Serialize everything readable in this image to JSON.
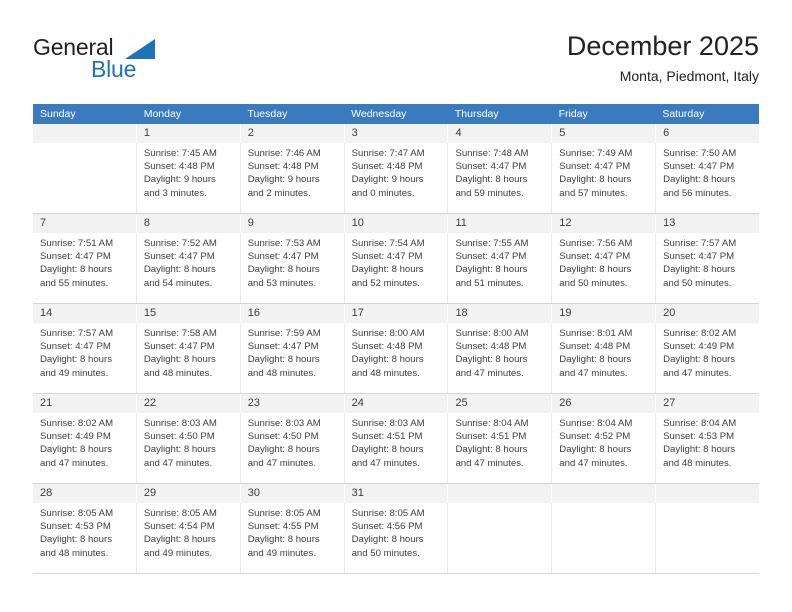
{
  "brand": {
    "name_part1": "General",
    "name_part2": "Blue",
    "accent_color": "#1e72bb",
    "logo_icon": "triangle-flag-icon"
  },
  "header": {
    "title": "December 2025",
    "subtitle": "Monta, Piedmont, Italy"
  },
  "calendar": {
    "header_bg": "#3a7bbf",
    "daynum_bg": "#f2f2f2",
    "weekdays": [
      "Sunday",
      "Monday",
      "Tuesday",
      "Wednesday",
      "Thursday",
      "Friday",
      "Saturday"
    ],
    "weeks": [
      {
        "days": [
          {
            "date": "",
            "sunrise": "",
            "sunset": "",
            "daylight_line1": "",
            "daylight_line2": "",
            "empty": true
          },
          {
            "date": "1",
            "sunrise": "Sunrise: 7:45 AM",
            "sunset": "Sunset: 4:48 PM",
            "daylight_line1": "Daylight: 9 hours",
            "daylight_line2": "and 3 minutes.",
            "empty": false
          },
          {
            "date": "2",
            "sunrise": "Sunrise: 7:46 AM",
            "sunset": "Sunset: 4:48 PM",
            "daylight_line1": "Daylight: 9 hours",
            "daylight_line2": "and 2 minutes.",
            "empty": false
          },
          {
            "date": "3",
            "sunrise": "Sunrise: 7:47 AM",
            "sunset": "Sunset: 4:48 PM",
            "daylight_line1": "Daylight: 9 hours",
            "daylight_line2": "and 0 minutes.",
            "empty": false
          },
          {
            "date": "4",
            "sunrise": "Sunrise: 7:48 AM",
            "sunset": "Sunset: 4:47 PM",
            "daylight_line1": "Daylight: 8 hours",
            "daylight_line2": "and 59 minutes.",
            "empty": false
          },
          {
            "date": "5",
            "sunrise": "Sunrise: 7:49 AM",
            "sunset": "Sunset: 4:47 PM",
            "daylight_line1": "Daylight: 8 hours",
            "daylight_line2": "and 57 minutes.",
            "empty": false
          },
          {
            "date": "6",
            "sunrise": "Sunrise: 7:50 AM",
            "sunset": "Sunset: 4:47 PM",
            "daylight_line1": "Daylight: 8 hours",
            "daylight_line2": "and 56 minutes.",
            "empty": false
          }
        ]
      },
      {
        "days": [
          {
            "date": "7",
            "sunrise": "Sunrise: 7:51 AM",
            "sunset": "Sunset: 4:47 PM",
            "daylight_line1": "Daylight: 8 hours",
            "daylight_line2": "and 55 minutes.",
            "empty": false
          },
          {
            "date": "8",
            "sunrise": "Sunrise: 7:52 AM",
            "sunset": "Sunset: 4:47 PM",
            "daylight_line1": "Daylight: 8 hours",
            "daylight_line2": "and 54 minutes.",
            "empty": false
          },
          {
            "date": "9",
            "sunrise": "Sunrise: 7:53 AM",
            "sunset": "Sunset: 4:47 PM",
            "daylight_line1": "Daylight: 8 hours",
            "daylight_line2": "and 53 minutes.",
            "empty": false
          },
          {
            "date": "10",
            "sunrise": "Sunrise: 7:54 AM",
            "sunset": "Sunset: 4:47 PM",
            "daylight_line1": "Daylight: 8 hours",
            "daylight_line2": "and 52 minutes.",
            "empty": false
          },
          {
            "date": "11",
            "sunrise": "Sunrise: 7:55 AM",
            "sunset": "Sunset: 4:47 PM",
            "daylight_line1": "Daylight: 8 hours",
            "daylight_line2": "and 51 minutes.",
            "empty": false
          },
          {
            "date": "12",
            "sunrise": "Sunrise: 7:56 AM",
            "sunset": "Sunset: 4:47 PM",
            "daylight_line1": "Daylight: 8 hours",
            "daylight_line2": "and 50 minutes.",
            "empty": false
          },
          {
            "date": "13",
            "sunrise": "Sunrise: 7:57 AM",
            "sunset": "Sunset: 4:47 PM",
            "daylight_line1": "Daylight: 8 hours",
            "daylight_line2": "and 50 minutes.",
            "empty": false
          }
        ]
      },
      {
        "days": [
          {
            "date": "14",
            "sunrise": "Sunrise: 7:57 AM",
            "sunset": "Sunset: 4:47 PM",
            "daylight_line1": "Daylight: 8 hours",
            "daylight_line2": "and 49 minutes.",
            "empty": false
          },
          {
            "date": "15",
            "sunrise": "Sunrise: 7:58 AM",
            "sunset": "Sunset: 4:47 PM",
            "daylight_line1": "Daylight: 8 hours",
            "daylight_line2": "and 48 minutes.",
            "empty": false
          },
          {
            "date": "16",
            "sunrise": "Sunrise: 7:59 AM",
            "sunset": "Sunset: 4:47 PM",
            "daylight_line1": "Daylight: 8 hours",
            "daylight_line2": "and 48 minutes.",
            "empty": false
          },
          {
            "date": "17",
            "sunrise": "Sunrise: 8:00 AM",
            "sunset": "Sunset: 4:48 PM",
            "daylight_line1": "Daylight: 8 hours",
            "daylight_line2": "and 48 minutes.",
            "empty": false
          },
          {
            "date": "18",
            "sunrise": "Sunrise: 8:00 AM",
            "sunset": "Sunset: 4:48 PM",
            "daylight_line1": "Daylight: 8 hours",
            "daylight_line2": "and 47 minutes.",
            "empty": false
          },
          {
            "date": "19",
            "sunrise": "Sunrise: 8:01 AM",
            "sunset": "Sunset: 4:48 PM",
            "daylight_line1": "Daylight: 8 hours",
            "daylight_line2": "and 47 minutes.",
            "empty": false
          },
          {
            "date": "20",
            "sunrise": "Sunrise: 8:02 AM",
            "sunset": "Sunset: 4:49 PM",
            "daylight_line1": "Daylight: 8 hours",
            "daylight_line2": "and 47 minutes.",
            "empty": false
          }
        ]
      },
      {
        "days": [
          {
            "date": "21",
            "sunrise": "Sunrise: 8:02 AM",
            "sunset": "Sunset: 4:49 PM",
            "daylight_line1": "Daylight: 8 hours",
            "daylight_line2": "and 47 minutes.",
            "empty": false
          },
          {
            "date": "22",
            "sunrise": "Sunrise: 8:03 AM",
            "sunset": "Sunset: 4:50 PM",
            "daylight_line1": "Daylight: 8 hours",
            "daylight_line2": "and 47 minutes.",
            "empty": false
          },
          {
            "date": "23",
            "sunrise": "Sunrise: 8:03 AM",
            "sunset": "Sunset: 4:50 PM",
            "daylight_line1": "Daylight: 8 hours",
            "daylight_line2": "and 47 minutes.",
            "empty": false
          },
          {
            "date": "24",
            "sunrise": "Sunrise: 8:03 AM",
            "sunset": "Sunset: 4:51 PM",
            "daylight_line1": "Daylight: 8 hours",
            "daylight_line2": "and 47 minutes.",
            "empty": false
          },
          {
            "date": "25",
            "sunrise": "Sunrise: 8:04 AM",
            "sunset": "Sunset: 4:51 PM",
            "daylight_line1": "Daylight: 8 hours",
            "daylight_line2": "and 47 minutes.",
            "empty": false
          },
          {
            "date": "26",
            "sunrise": "Sunrise: 8:04 AM",
            "sunset": "Sunset: 4:52 PM",
            "daylight_line1": "Daylight: 8 hours",
            "daylight_line2": "and 47 minutes.",
            "empty": false
          },
          {
            "date": "27",
            "sunrise": "Sunrise: 8:04 AM",
            "sunset": "Sunset: 4:53 PM",
            "daylight_line1": "Daylight: 8 hours",
            "daylight_line2": "and 48 minutes.",
            "empty": false
          }
        ]
      },
      {
        "days": [
          {
            "date": "28",
            "sunrise": "Sunrise: 8:05 AM",
            "sunset": "Sunset: 4:53 PM",
            "daylight_line1": "Daylight: 8 hours",
            "daylight_line2": "and 48 minutes.",
            "empty": false
          },
          {
            "date": "29",
            "sunrise": "Sunrise: 8:05 AM",
            "sunset": "Sunset: 4:54 PM",
            "daylight_line1": "Daylight: 8 hours",
            "daylight_line2": "and 49 minutes.",
            "empty": false
          },
          {
            "date": "30",
            "sunrise": "Sunrise: 8:05 AM",
            "sunset": "Sunset: 4:55 PM",
            "daylight_line1": "Daylight: 8 hours",
            "daylight_line2": "and 49 minutes.",
            "empty": false
          },
          {
            "date": "31",
            "sunrise": "Sunrise: 8:05 AM",
            "sunset": "Sunset: 4:56 PM",
            "daylight_line1": "Daylight: 8 hours",
            "daylight_line2": "and 50 minutes.",
            "empty": false
          },
          {
            "date": "",
            "sunrise": "",
            "sunset": "",
            "daylight_line1": "",
            "daylight_line2": "",
            "empty": true
          },
          {
            "date": "",
            "sunrise": "",
            "sunset": "",
            "daylight_line1": "",
            "daylight_line2": "",
            "empty": true
          },
          {
            "date": "",
            "sunrise": "",
            "sunset": "",
            "daylight_line1": "",
            "daylight_line2": "",
            "empty": true
          }
        ]
      }
    ]
  }
}
